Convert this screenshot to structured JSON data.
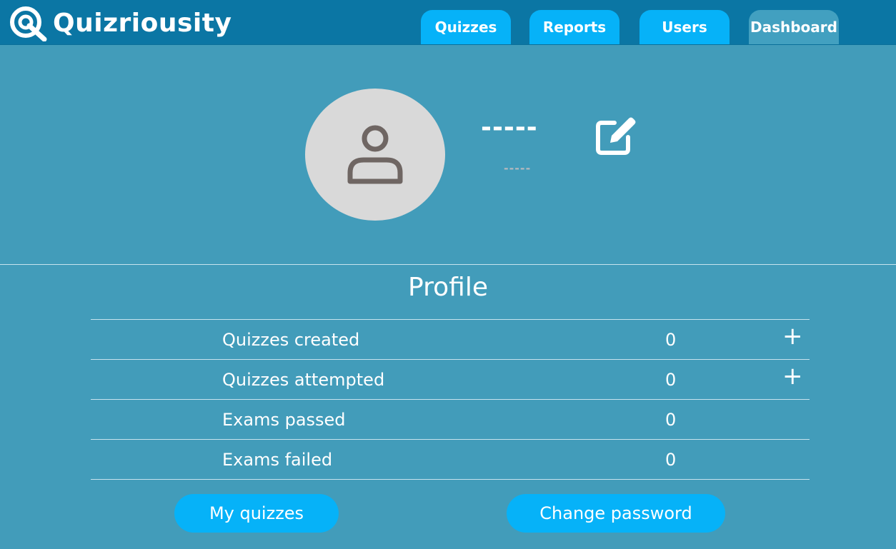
{
  "app": {
    "name": "Quizriousity",
    "brand_color": "#0b76a4",
    "accent_color": "#06b2f8",
    "background_color": "#429cba"
  },
  "nav": {
    "tabs": [
      {
        "label": "Quizzes"
      },
      {
        "label": "Reports"
      },
      {
        "label": "Users"
      },
      {
        "label": "Dashboard",
        "active": true
      }
    ]
  },
  "profile": {
    "avatar_icon": "user-icon",
    "username": "-----",
    "subtext": "-----",
    "edit_icon": "edit-icon",
    "section_title": "Profile",
    "stats": [
      {
        "label": "Quizzes created",
        "value": "0",
        "action": "+"
      },
      {
        "label": "Quizzes attempted",
        "value": "0",
        "action": "+"
      },
      {
        "label": "Exams passed",
        "value": "0"
      },
      {
        "label": "Exams failed",
        "value": "0"
      }
    ],
    "buttons": {
      "my_quizzes": "My quizzes",
      "change_password": "Change password"
    }
  }
}
